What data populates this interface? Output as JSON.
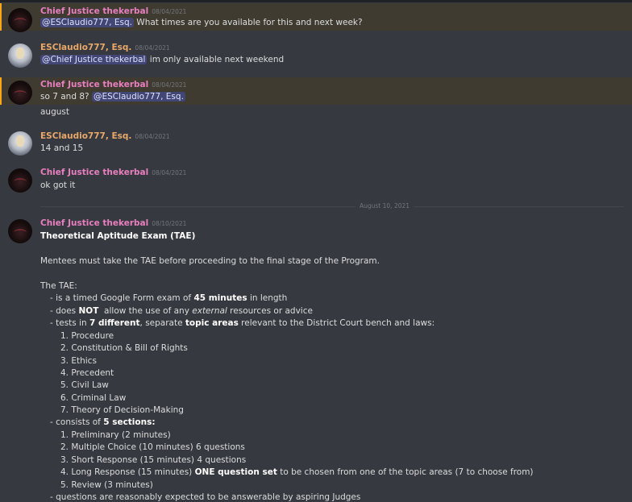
{
  "messages": [
    {
      "author": "Chief Justice thekerbal",
      "time": "08/04/2021",
      "mention": "@ESClaudio777, Esq.",
      "text": " What times are you available for this and next week?"
    },
    {
      "author": "ESClaudio777, Esq.",
      "time": "08/04/2021",
      "mention": "@Chief Justice thekerbal",
      "text": " im only available next weekend"
    },
    {
      "author": "Chief Justice thekerbal",
      "time": "08/04/2021",
      "text_pre": "so 7 and 8? ",
      "mention": "@ESClaudio777, Esq.",
      "line2": "august"
    },
    {
      "author": "ESClaudio777, Esq.",
      "time": "08/04/2021",
      "text": "14 and 15"
    },
    {
      "author": "Chief Justice thekerbal",
      "time": "08/04/2021",
      "text": "ok got it"
    }
  ],
  "divider": "August 10, 2021",
  "tae": {
    "author": "Chief Justice thekerbal",
    "time": "08/10/2021",
    "title": "Theoretical Aptitude Exam (TAE)",
    "intro": "Mentees must take the TAE before proceeding to the final stage of the Program.",
    "heading": "The TAE:",
    "b1_pre": "- is a timed Google Form exam of ",
    "b1_bold": "45 minutes",
    "b1_post": " in length",
    "b2_pre": "- does ",
    "b2_bold": "NOT",
    "b2_mid": "  allow the use of any ",
    "b2_italic": "external",
    "b2_post": " resources or advice",
    "b3_pre": "- tests in ",
    "b3_bold1": "7 different",
    "b3_mid": ", separate ",
    "b3_bold2": "topic areas",
    "b3_post": " relevant to the District Court bench and laws:",
    "topics": [
      "1. Procedure",
      "2. Constitution & Bill of Rights",
      "3. Ethics",
      "4. Precedent",
      "5. Civil Law",
      "6. Criminal Law",
      "7. Theory of Decision-Making"
    ],
    "b4_pre": "- consists of ",
    "b4_bold": "5 sections:",
    "s1": "1. Preliminary (2 minutes)",
    "s2": "2. Multiple Choice (10 minutes) 6 questions",
    "s3": "3. Short Response (15 minutes) 4 questions",
    "s4_pre": "4. Long Response (15 minutes) ",
    "s4_bold": "ONE question set",
    "s4_post": " to be chosen from one of the topic areas (7 to choose from)",
    "s5": "5. Review (3 minutes)",
    "b5": "- questions are reasonably expected to be answerable by aspiring Judges"
  }
}
